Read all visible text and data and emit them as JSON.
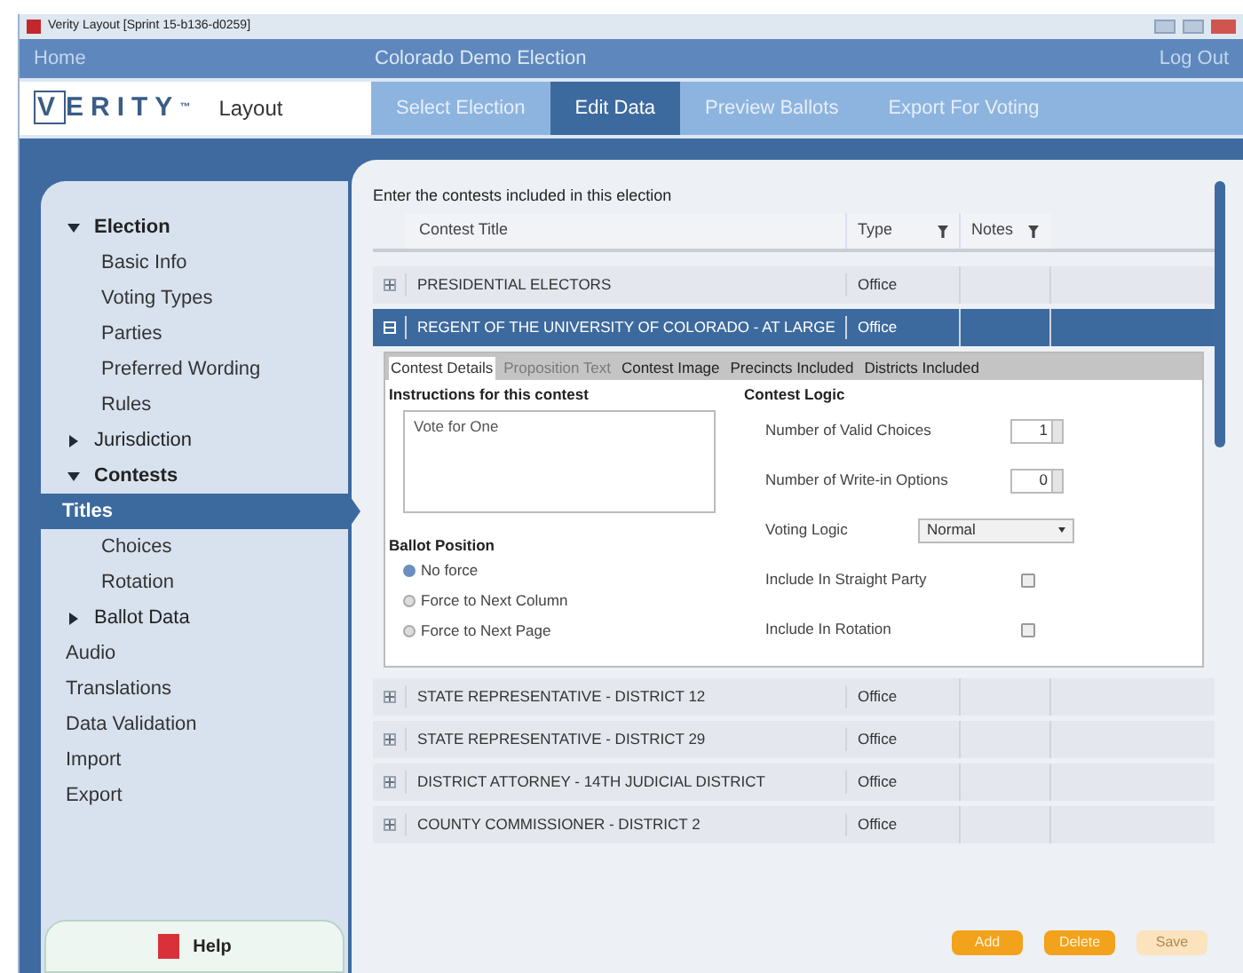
{
  "window": {
    "title": "Verity Layout [Sprint 15-b136-d0259]"
  },
  "header": {
    "home": "Home",
    "election": "Colorado Demo Election",
    "logout": "Log Out"
  },
  "brand": {
    "logo": "VERITY",
    "tm": "™",
    "product": "Layout"
  },
  "steps": [
    {
      "label": "Select Election",
      "selected": false
    },
    {
      "label": "Edit Data",
      "selected": true
    },
    {
      "label": "Preview Ballots",
      "selected": false
    },
    {
      "label": "Export For Voting",
      "selected": false
    }
  ],
  "sidebar": {
    "items": [
      {
        "label": "Election",
        "expanded": true,
        "children": [
          {
            "label": "Basic Info",
            "selected": false
          },
          {
            "label": "Voting Types",
            "selected": false
          },
          {
            "label": "Parties",
            "selected": false
          },
          {
            "label": "Preferred Wording",
            "selected": false
          },
          {
            "label": "Rules",
            "selected": false
          }
        ]
      },
      {
        "label": "Jurisdiction",
        "expanded": false
      },
      {
        "label": "Contests",
        "expanded": true,
        "children": [
          {
            "label": "Titles",
            "selected": true
          },
          {
            "label": "Choices",
            "selected": false
          },
          {
            "label": "Rotation",
            "selected": false
          }
        ]
      },
      {
        "label": "Ballot Data",
        "expanded": false
      },
      {
        "label": "Audio",
        "selected": false
      },
      {
        "label": "Translations",
        "selected": false
      },
      {
        "label": "Data Validation",
        "selected": false
      },
      {
        "label": "Import",
        "selected": false
      },
      {
        "label": "Export",
        "selected": false
      }
    ],
    "help": "Help"
  },
  "intro": "Enter the contests included in this election",
  "table": {
    "columns": [
      "Contest Title",
      "Type",
      "Notes"
    ],
    "rows": [
      {
        "title": "PRESIDENTIAL ELECTORS",
        "type": "Office",
        "expanded": false,
        "selected": false
      },
      {
        "title": "REGENT OF THE UNIVERSITY OF COLORADO - AT LARGE",
        "type": "Office",
        "expanded": true,
        "selected": true
      },
      {
        "title": "STATE REPRESENTATIVE - DISTRICT 12",
        "type": "Office",
        "expanded": false,
        "selected": false
      },
      {
        "title": "STATE REPRESENTATIVE - DISTRICT 29",
        "type": "Office",
        "expanded": false,
        "selected": false
      },
      {
        "title": "DISTRICT ATTORNEY - 14TH JUDICIAL DISTRICT",
        "type": "Office",
        "expanded": false,
        "selected": false
      },
      {
        "title": "COUNTY COMMISSIONER - DISTRICT 2",
        "type": "Office",
        "expanded": false,
        "selected": false
      }
    ]
  },
  "details": {
    "tabs": [
      {
        "label": "Contest Details",
        "selected": true,
        "disabled": false
      },
      {
        "label": "Proposition Text",
        "selected": false,
        "disabled": true
      },
      {
        "label": "Contest Image",
        "selected": false,
        "disabled": false
      },
      {
        "label": "Precincts Included",
        "selected": false,
        "disabled": false
      },
      {
        "label": "Districts Included",
        "selected": false,
        "disabled": false
      }
    ],
    "instructions_heading": "Instructions for this contest",
    "instructions": "Vote for One",
    "ballot_position_heading": "Ballot Position",
    "positions": [
      {
        "label": "No force",
        "selected": true
      },
      {
        "label": "Force to Next Column",
        "selected": false
      },
      {
        "label": "Force to Next Page",
        "selected": false
      }
    ],
    "logic_heading": "Contest Logic",
    "fields": [
      {
        "kind": "spinner",
        "label": "Number of Valid Choices",
        "value": "1"
      },
      {
        "kind": "spinner",
        "label": "Number of Write-in Options",
        "value": "0"
      },
      {
        "kind": "select",
        "label": "Voting Logic",
        "value": "Normal"
      },
      {
        "kind": "checkbox",
        "label": "Include In Straight Party",
        "checked": false
      },
      {
        "kind": "checkbox",
        "label": "Include In Rotation",
        "checked": false
      }
    ]
  },
  "buttons": [
    {
      "label": "Add",
      "disabled": false
    },
    {
      "label": "Delete",
      "disabled": false
    },
    {
      "label": "Save",
      "disabled": true
    }
  ]
}
